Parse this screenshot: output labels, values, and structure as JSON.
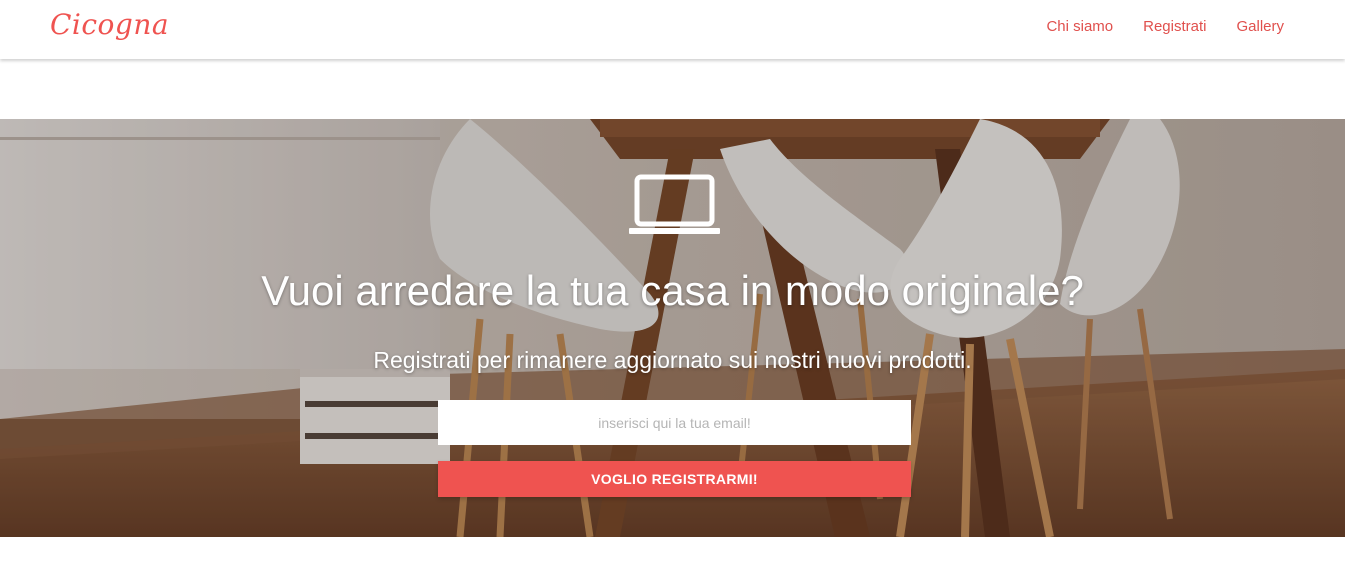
{
  "navbar": {
    "brand": "Cicogna",
    "links": [
      {
        "label": "Chi siamo"
      },
      {
        "label": "Registrati"
      },
      {
        "label": "Gallery"
      }
    ]
  },
  "hero": {
    "icon": "laptop-icon",
    "title": "Vuoi arredare la tua casa in modo originale?",
    "subtitle": "Registrati per rimanere aggiornato sui nostri nuovi prodotti.",
    "email_placeholder": "inserisci qui la tua email!",
    "email_value": "",
    "button_label": "VOGLIO REGISTRARMI!"
  },
  "colors": {
    "accent": "#ef5350",
    "nav_link": "#e0504d",
    "hero_text": "#ffffff"
  }
}
